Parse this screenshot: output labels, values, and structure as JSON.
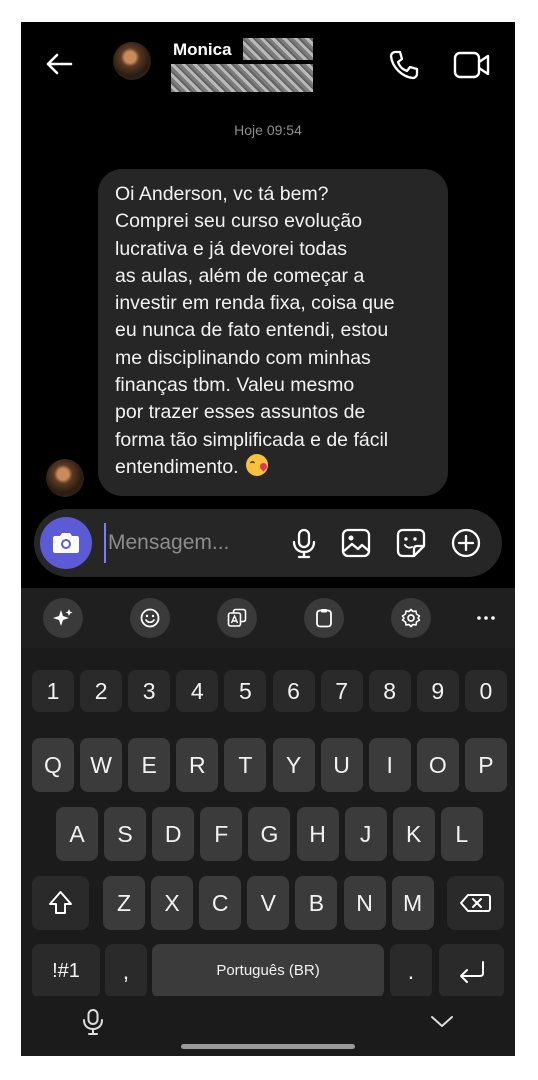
{
  "header": {
    "contact_name": "Monica",
    "back_icon": "arrow-left-icon",
    "call_icon": "phone-icon",
    "video_icon": "video-camera-icon"
  },
  "chat": {
    "timestamp": "Hoje 09:54",
    "message_lines": [
      "Oi Anderson, vc tá bem?",
      "Comprei seu curso evolução",
      "lucrativa e já devorei todas",
      "as aulas, além de começar a",
      "investir em renda fixa, coisa que",
      "eu nunca de fato entendi, estou",
      "me disciplinando com minhas",
      "finanças tbm. Valeu mesmo",
      "por trazer esses assuntos de",
      "forma tão simplificada e de fácil",
      "entendimento."
    ],
    "message_emoji": "kissing-face-emoji"
  },
  "composer": {
    "placeholder": "Mensagem...",
    "camera_color": "#5b5bd6"
  },
  "keyboard": {
    "toolbar_icons": [
      "sparkle-icon",
      "emoji-icon",
      "translate-icon",
      "clipboard-icon",
      "settings-icon",
      "more-icon"
    ],
    "more_label": "···",
    "number_row": [
      "1",
      "2",
      "3",
      "4",
      "5",
      "6",
      "7",
      "8",
      "9",
      "0"
    ],
    "row1": [
      "Q",
      "W",
      "E",
      "R",
      "T",
      "Y",
      "U",
      "I",
      "O",
      "P"
    ],
    "row2": [
      "A",
      "S",
      "D",
      "F",
      "G",
      "H",
      "J",
      "K",
      "L"
    ],
    "row3": [
      "Z",
      "X",
      "C",
      "V",
      "B",
      "N",
      "M"
    ],
    "symbols_label": "!#1",
    "comma_label": ",",
    "space_label": "Português (BR)",
    "period_label": "."
  }
}
